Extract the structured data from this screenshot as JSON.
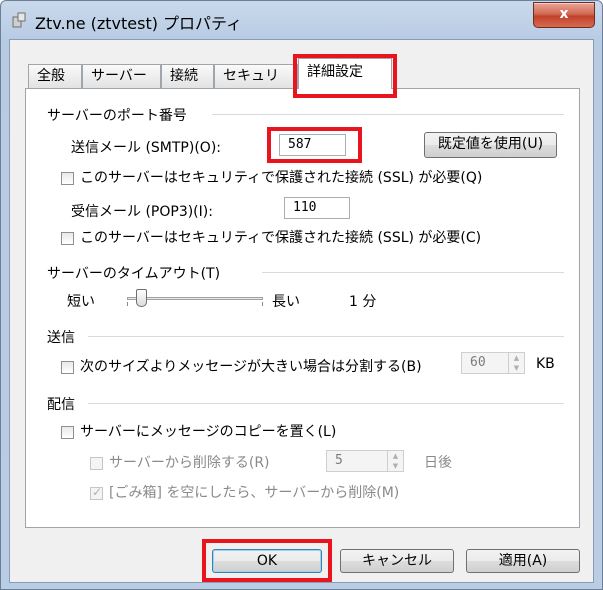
{
  "window": {
    "title": "Ztv.ne (ztvtest) プロパティ",
    "close_label": "x"
  },
  "tabs": [
    {
      "label": "全般"
    },
    {
      "label": "サーバー"
    },
    {
      "label": "接続"
    },
    {
      "label": "セキュリティ"
    },
    {
      "label": "詳細設定",
      "active": true
    }
  ],
  "ports": {
    "group_label": "サーバーのポート番号",
    "smtp_label": "送信メール (SMTP)(O):",
    "smtp_value": "587",
    "default_button": "既定値を使用(U)",
    "smtp_ssl_label": "このサーバーはセキュリティで保護された接続 (SSL) が必要(Q)",
    "pop3_label": "受信メール (POP3)(I):",
    "pop3_value": "110",
    "pop3_ssl_label": "このサーバーはセキュリティで保護された接続 (SSL) が必要(C)"
  },
  "timeout": {
    "group_label": "サーバーのタイムアウト(T)",
    "short_label": "短い",
    "long_label": "長い",
    "value_text": "1 分",
    "slider_fraction": 0.1
  },
  "sending": {
    "group_label": "送信",
    "split_label": "次のサイズよりメッセージが大きい場合は分割する(B)",
    "split_value": "60",
    "split_unit": "KB"
  },
  "delivery": {
    "group_label": "配信",
    "leave_copy_label": "サーバーにメッセージのコピーを置く(L)",
    "remove_after_label": "サーバーから削除する(R)",
    "remove_after_value": "5",
    "remove_after_unit": "日後",
    "remove_on_empty_label": "[ごみ箱] を空にしたら、サーバーから削除(M)"
  },
  "buttons": {
    "ok": "OK",
    "cancel": "キャンセル",
    "apply": "適用(A)"
  },
  "colors": {
    "highlight": "#e8141e",
    "titlebar": "#c9d9ec",
    "close": "#c0412a"
  }
}
